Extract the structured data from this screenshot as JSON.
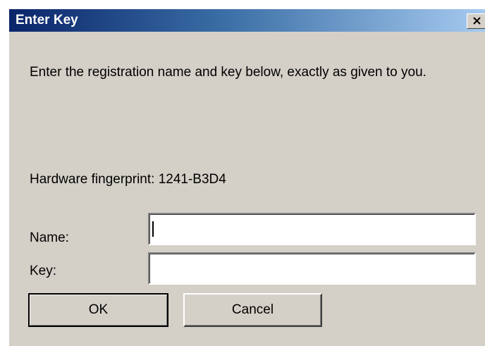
{
  "window": {
    "title": "Enter Key",
    "close_icon": "close-icon"
  },
  "dialog": {
    "instructions": "Enter the registration name and key below, exactly as given to you.",
    "fingerprint": "Hardware fingerprint: 1241-B3D4",
    "name_label": "Name:",
    "name_value": "",
    "key_label": "Key:",
    "key_value": "",
    "ok_label": "OK",
    "cancel_label": "Cancel"
  },
  "colors": {
    "titlebar_start": "#0a246a",
    "titlebar_end": "#a6caf0",
    "face": "#d4d0c8"
  }
}
